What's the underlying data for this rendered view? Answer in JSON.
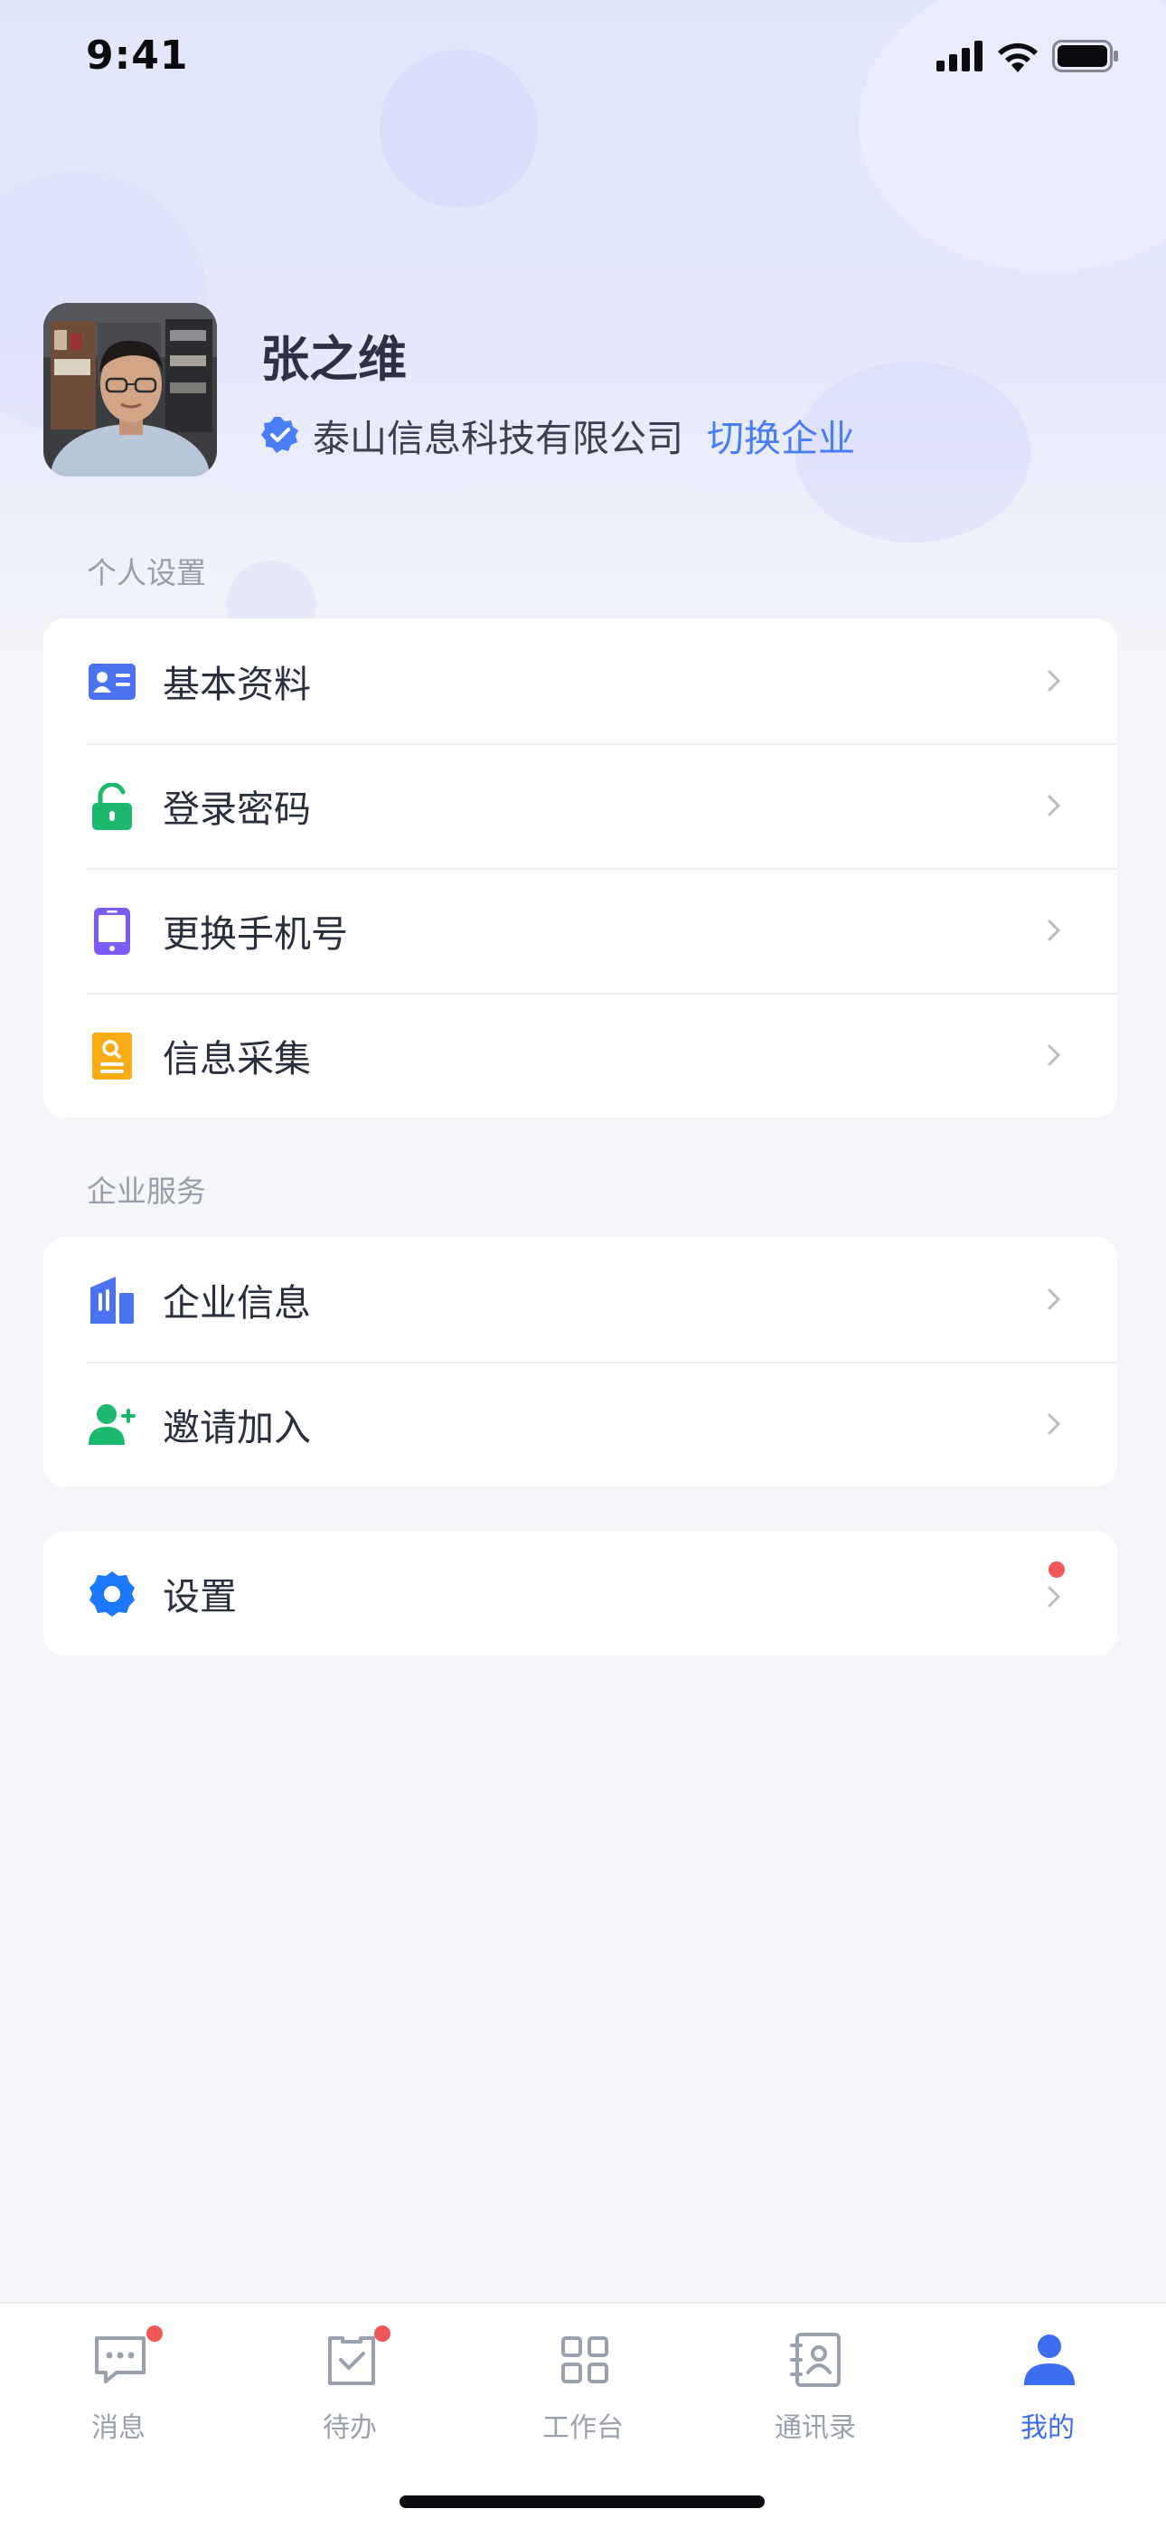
{
  "status": {
    "time": "9:41"
  },
  "profile": {
    "name": "张之维",
    "company": "泰山信息科技有限公司",
    "switch_label": "切换企业"
  },
  "personal": {
    "section_title": "个人设置",
    "items": [
      {
        "label": "基本资料",
        "icon": "id-card-icon",
        "color": "#4b73f0"
      },
      {
        "label": "登录密码",
        "icon": "unlock-icon",
        "color": "#1cb86e"
      },
      {
        "label": "更换手机号",
        "icon": "phone-icon",
        "color": "#7d5cf6"
      },
      {
        "label": "信息采集",
        "icon": "document-search-icon",
        "color": "#f8ad17"
      }
    ]
  },
  "enterprise": {
    "section_title": "企业服务",
    "items": [
      {
        "label": "企业信息",
        "icon": "building-icon",
        "color": "#4b73f0"
      },
      {
        "label": "邀请加入",
        "icon": "add-user-icon",
        "color": "#1cb86e"
      }
    ]
  },
  "settings": {
    "label": "设置",
    "icon": "gear-icon",
    "color": "#1b78ff",
    "has_badge": true
  },
  "tabbar": {
    "items": [
      {
        "label": "消息",
        "icon": "message-icon",
        "badge": true,
        "active": false
      },
      {
        "label": "待办",
        "icon": "todo-icon",
        "badge": true,
        "active": false
      },
      {
        "label": "工作台",
        "icon": "grid-icon",
        "badge": false,
        "active": false
      },
      {
        "label": "通讯录",
        "icon": "contacts-icon",
        "badge": false,
        "active": false
      },
      {
        "label": "我的",
        "icon": "user-icon",
        "badge": false,
        "active": true
      }
    ]
  },
  "colors": {
    "accent": "#4a7ef7",
    "badge": "#f25757",
    "tab_active": "#3c6cf0",
    "tab_inactive": "#9aa0ad"
  }
}
